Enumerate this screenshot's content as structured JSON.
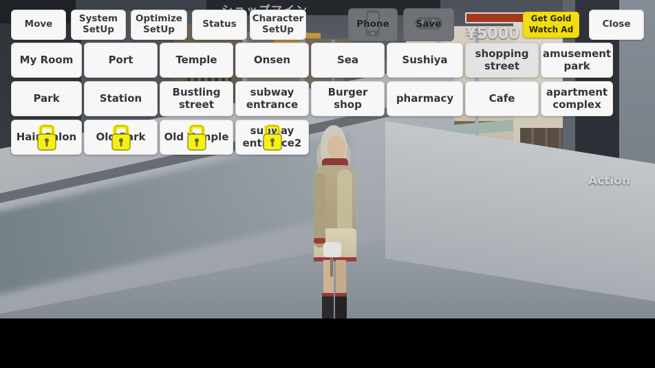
{
  "toolbar": {
    "buttons": [
      {
        "label": "Move",
        "name": "move-button"
      },
      {
        "label": "System\nSetUp",
        "name": "system-setup-button"
      },
      {
        "label": "Optimize\nSetUp",
        "name": "optimize-setup-button"
      },
      {
        "label": "Status",
        "name": "status-button"
      },
      {
        "label": "Character\nSetUp",
        "name": "character-setup-button"
      }
    ],
    "phone_label": "Phone",
    "save_label": "Save",
    "close_label": "Close",
    "phone_icon": "smartphone-icon",
    "save_icon": "gamepad-icon"
  },
  "money": {
    "amount": "¥5000",
    "bar_fill_percent": 100,
    "bar_color": "#a8381a",
    "get_gold_line1": "Get Gold",
    "get_gold_line2": "Watch Ad",
    "get_gold_color": "#f2dd11"
  },
  "locations": {
    "rows": [
      [
        {
          "label": "My Room",
          "locked": false,
          "current": false
        },
        {
          "label": "Port",
          "locked": false,
          "current": false
        },
        {
          "label": "Temple",
          "locked": false,
          "current": false
        },
        {
          "label": "Onsen",
          "locked": false,
          "current": false
        },
        {
          "label": "Sea",
          "locked": false,
          "current": false
        },
        {
          "label": "Sushiya",
          "locked": false,
          "current": false
        },
        {
          "label": "shopping\nstreet",
          "locked": false,
          "current": true
        },
        {
          "label": "amusement\npark",
          "locked": false,
          "current": false
        }
      ],
      [
        {
          "label": "Park",
          "locked": false,
          "current": false
        },
        {
          "label": "Station",
          "locked": false,
          "current": false
        },
        {
          "label": "Bustling\nstreet",
          "locked": false,
          "current": false
        },
        {
          "label": "subway\nentrance",
          "locked": false,
          "current": false
        },
        {
          "label": "Burger\nshop",
          "locked": false,
          "current": false
        },
        {
          "label": "pharmacy",
          "locked": false,
          "current": false
        },
        {
          "label": "Cafe",
          "locked": false,
          "current": false
        },
        {
          "label": "apartment\ncomplex",
          "locked": false,
          "current": false
        }
      ],
      [
        {
          "label": "Hair Salon",
          "locked": true,
          "current": false
        },
        {
          "label": "Old Park",
          "locked": true,
          "current": false
        },
        {
          "label": "Old Temple",
          "locked": true,
          "current": false
        },
        {
          "label": "subway\nentrance2",
          "locked": true,
          "current": false
        }
      ]
    ],
    "lock_icon": "padlock-icon",
    "lock_color": "#f5ef1a"
  },
  "scene": {
    "action_label": "Action",
    "shop_sign_text": "ショップマイン"
  }
}
